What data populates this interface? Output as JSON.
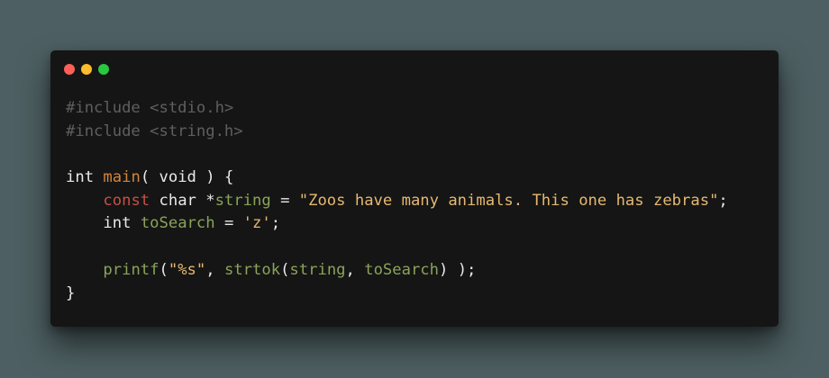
{
  "window": {
    "controls": [
      {
        "name": "close",
        "color": "#ff5f57"
      },
      {
        "name": "minimize",
        "color": "#febc2e"
      },
      {
        "name": "maximize",
        "color": "#28c840"
      }
    ]
  },
  "code": {
    "language": "c",
    "lines": [
      {
        "include1": "#include <stdio.h>"
      },
      {
        "include2": "#include <string.h>"
      },
      {},
      {
        "t1": "int",
        "sp1": " ",
        "fn": "main",
        "rest": "( void ) {"
      },
      {
        "indent": "    ",
        "kw": "const",
        "sp1": " ",
        "type": "char",
        "sp2": " *",
        "var": "string",
        "eq": " = ",
        "str": "\"Zoos have many animals. This one has zebras\"",
        "end": ";"
      },
      {
        "indent": "    ",
        "type": "int",
        "sp1": " ",
        "var": "toSearch",
        "eq": " = ",
        "str": "'z'",
        "end": ";"
      },
      {},
      {
        "indent": "    ",
        "call": "printf",
        "p1": "(",
        "str": "\"%s\"",
        "p2": ", ",
        "call2": "strtok",
        "p3": "(",
        "arg1": "string",
        "comma": ", ",
        "arg2": "toSearch",
        "end": ") );"
      },
      {
        "close": "}"
      }
    ]
  },
  "colors": {
    "background": "#4d5f62",
    "editor": "#151515",
    "preprocessor": "#5f5f5f",
    "function": "#d5843e",
    "keyword": "#c75046",
    "identifier": "#8aa35a",
    "string": "#e7b871",
    "text": "#e9e9e9"
  }
}
